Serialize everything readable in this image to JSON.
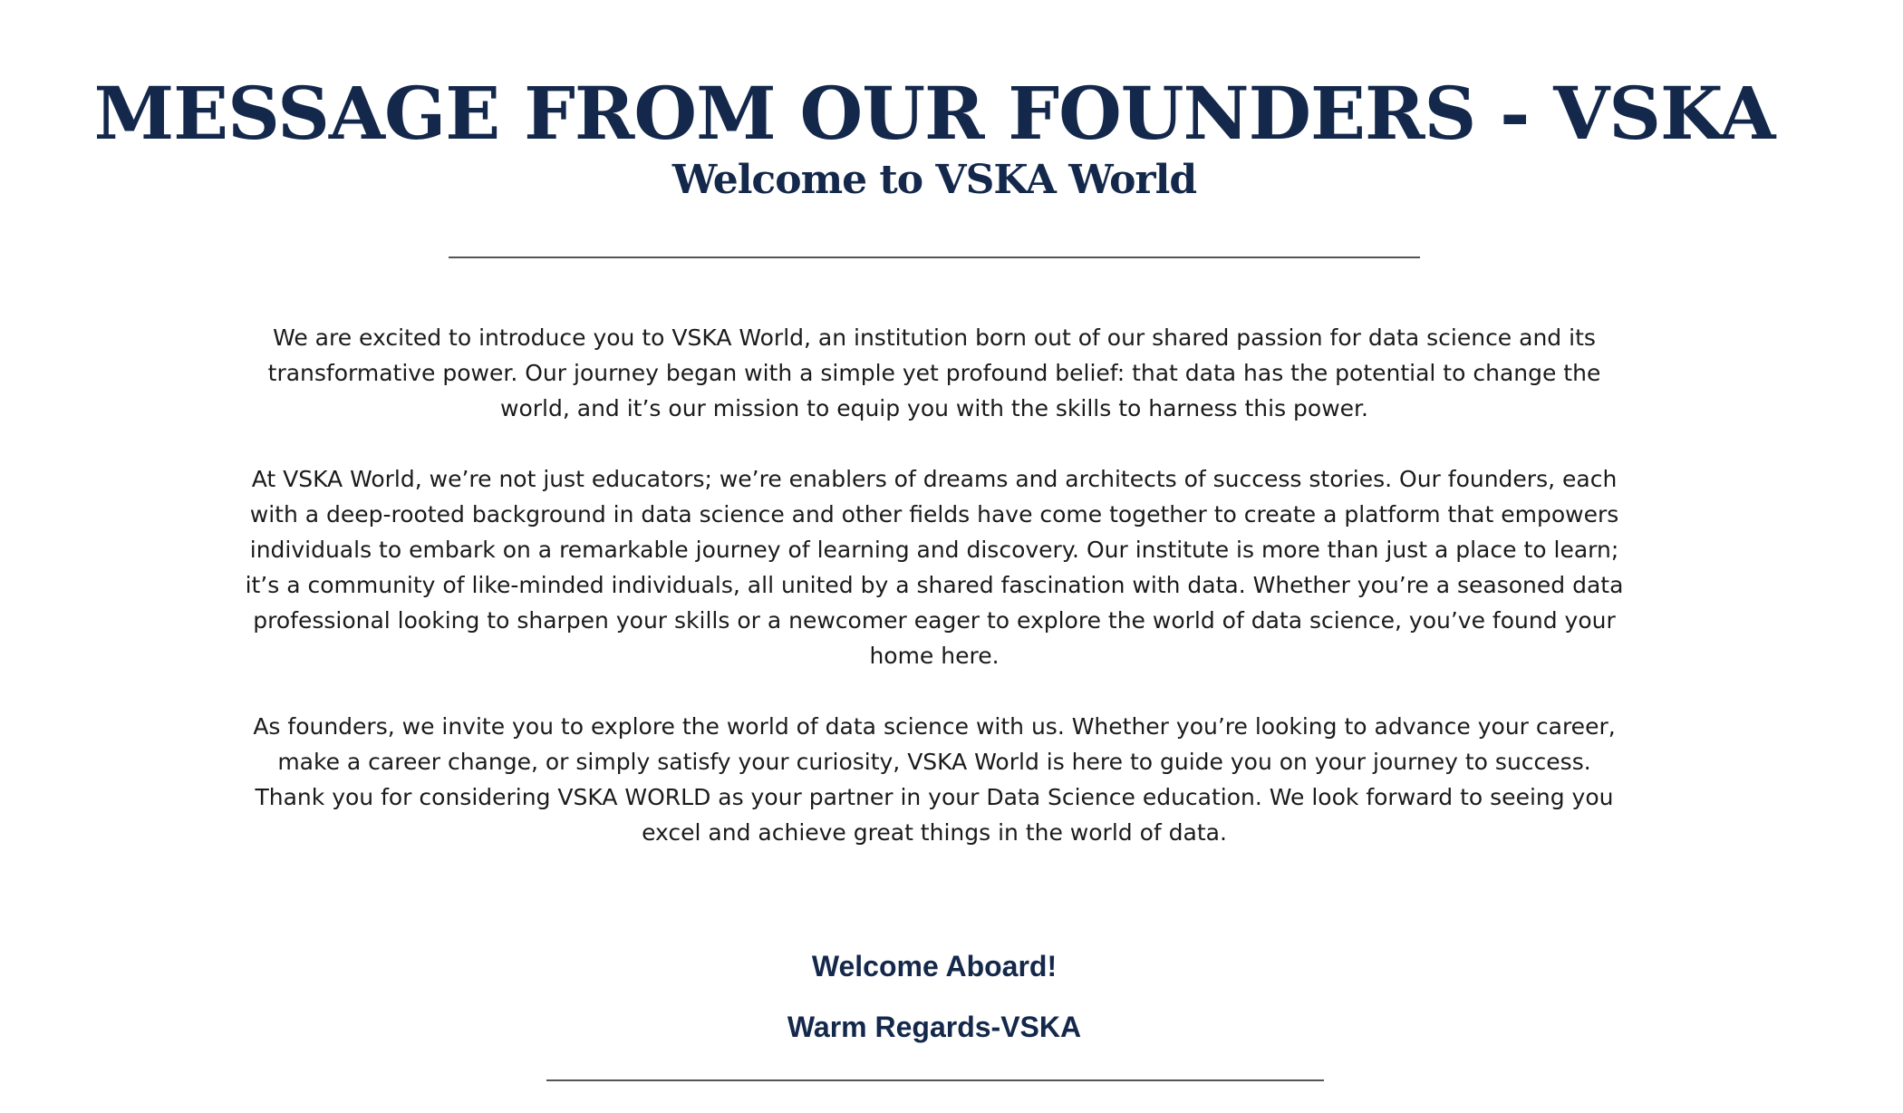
{
  "heading": {
    "title": "MESSAGE FROM OUR FOUNDERS - VSKA",
    "subtitle": "Welcome to VSKA World"
  },
  "body": {
    "paragraph_1": "We are excited to introduce you to VSKA World, an institution born out of our shared passion for data science and its transformative power. Our journey began with a simple yet profound belief: that data has the potential to change the world, and it’s our mission to equip you with the skills to harness this power.",
    "paragraph_2": "At VSKA World, we’re not just educators; we’re enablers of dreams and architects of success stories. Our founders, each with a deep-rooted background in data science and other fields have come together to create a platform that empowers individuals to embark on a remarkable journey of learning and discovery. Our institute is more than just a place to learn; it’s a community of like-minded individuals, all united by a shared fascination with data. Whether you’re a seasoned data professional looking to sharpen your skills or a newcomer eager to explore the world of data science, you’ve found your home here.",
    "paragraph_3": "As founders, we invite you to explore the world of data science with us. Whether you’re looking to advance your career, make a career change, or simply satisfy your curiosity, VSKA World is here to guide you on your journey to success. Thank you for considering VSKA WORLD as your partner in your Data Science education. We look forward to seeing you excel and achieve great things in the world of data."
  },
  "closing": {
    "welcome": "Welcome Aboard!",
    "regards": "Warm Regards-VSKA"
  },
  "colors": {
    "heading": "#14284b",
    "body_text": "#1b1b1b",
    "divider": "#555555",
    "background": "#ffffff"
  }
}
